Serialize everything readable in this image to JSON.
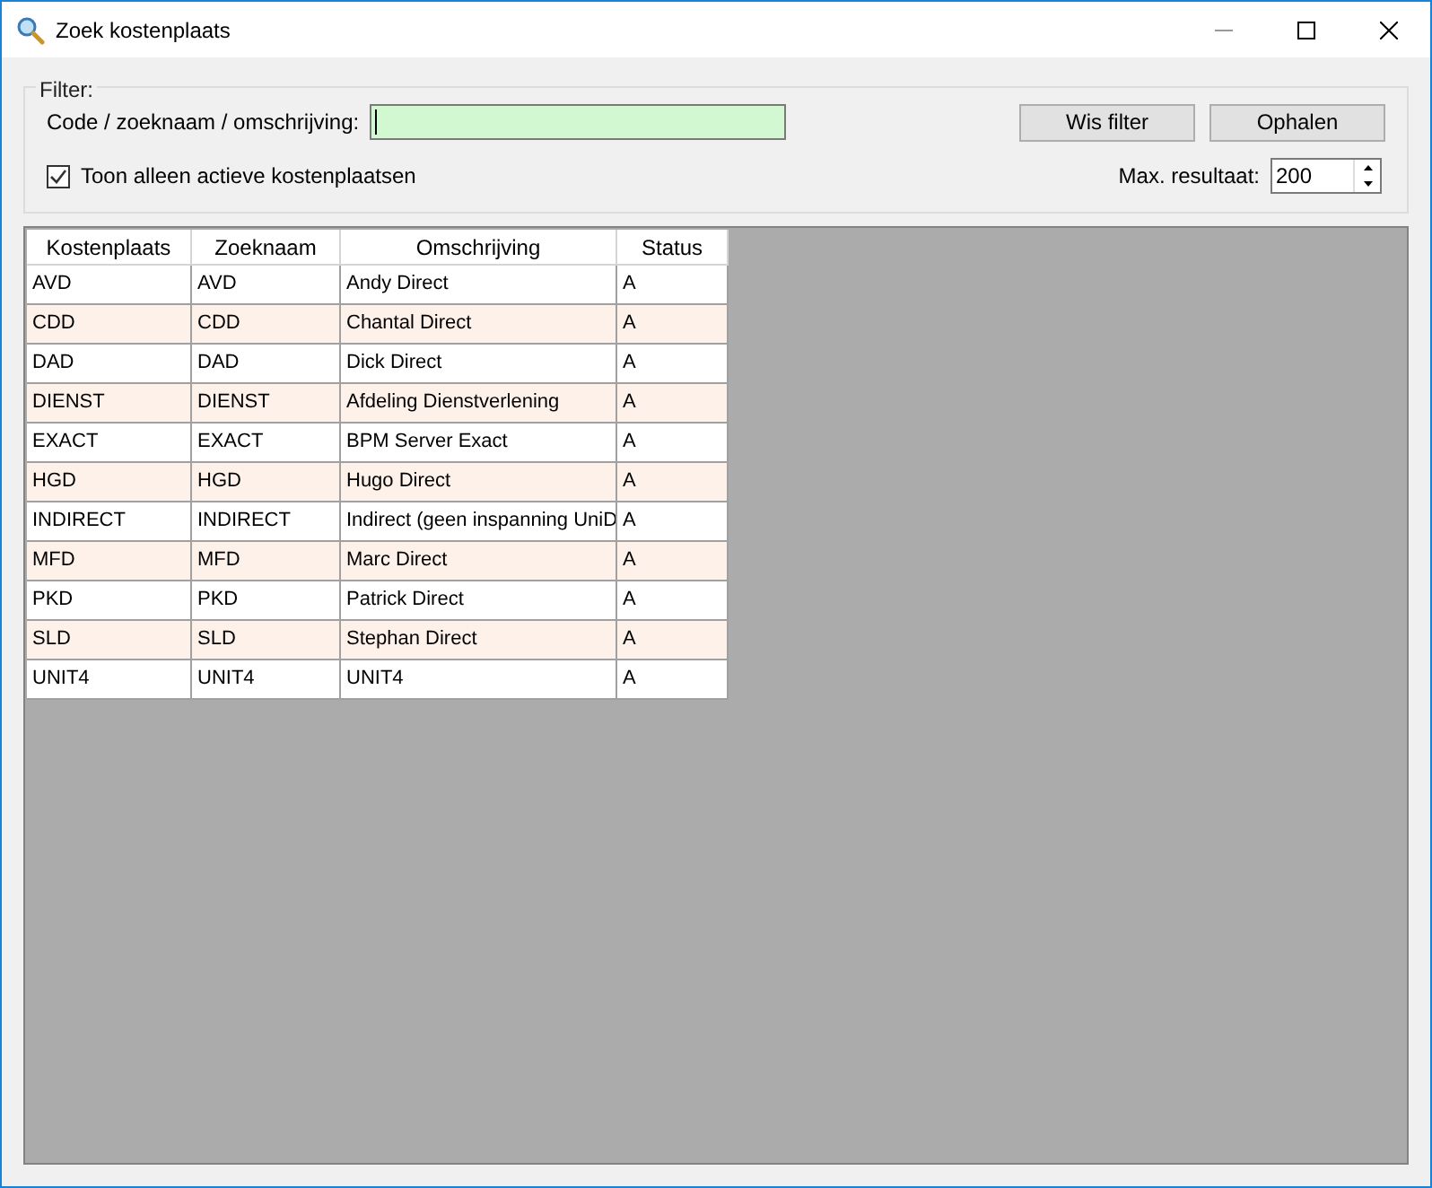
{
  "window": {
    "title": "Zoek kostenplaats"
  },
  "filter": {
    "legend": "Filter:",
    "search_label": "Code / zoeknaam / omschrijving:",
    "active_only": {
      "label": "Toon alleen actieve kostenplaatsen",
      "checked": true
    },
    "buttons": [
      "Wis filter",
      "Ophalen"
    ],
    "max_label": "Max. resultaat:",
    "max_value": "200"
  },
  "table": {
    "columns": [
      "Kostenplaats",
      "Zoeknaam",
      "Omschrijving",
      "Status"
    ],
    "rows": [
      [
        "AVD",
        "AVD",
        "Andy Direct",
        "A"
      ],
      [
        "CDD",
        "CDD",
        "Chantal Direct",
        "A"
      ],
      [
        "DAD",
        "DAD",
        "Dick Direct",
        "A"
      ],
      [
        "DIENST",
        "DIENST",
        "Afdeling Dienstverlening",
        "A"
      ],
      [
        "EXACT",
        "EXACT",
        "BPM Server Exact",
        "A"
      ],
      [
        "HGD",
        "HGD",
        "Hugo Direct",
        "A"
      ],
      [
        "INDIRECT",
        "INDIRECT",
        "Indirect (geen inspanning UniD",
        "A"
      ],
      [
        "MFD",
        "MFD",
        "Marc Direct",
        "A"
      ],
      [
        "PKD",
        "PKD",
        "Patrick Direct",
        "A"
      ],
      [
        "SLD",
        "SLD",
        "Stephan Direct",
        "A"
      ],
      [
        "UNIT4",
        "UNIT4",
        "UNIT4",
        "A"
      ]
    ]
  }
}
